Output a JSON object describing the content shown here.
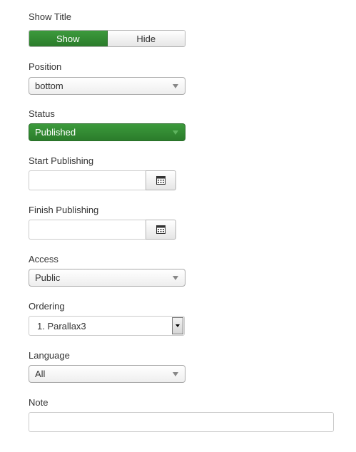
{
  "fields": {
    "show_title": {
      "label": "Show Title",
      "options": [
        "Show",
        "Hide"
      ],
      "selected": "Show"
    },
    "position": {
      "label": "Position",
      "value": "bottom"
    },
    "status": {
      "label": "Status",
      "value": "Published"
    },
    "start_publishing": {
      "label": "Start Publishing",
      "value": ""
    },
    "finish_publishing": {
      "label": "Finish Publishing",
      "value": ""
    },
    "access": {
      "label": "Access",
      "value": "Public"
    },
    "ordering": {
      "label": "Ordering",
      "value": "1. Parallax3"
    },
    "language": {
      "label": "Language",
      "value": "All"
    },
    "note": {
      "label": "Note",
      "value": ""
    }
  },
  "icons": {
    "calendar": "calendar-icon",
    "caret": "caret-down-icon"
  },
  "colors": {
    "active_green": "#2f8a2f",
    "text": "#333333",
    "border": "#aaaaaa"
  }
}
